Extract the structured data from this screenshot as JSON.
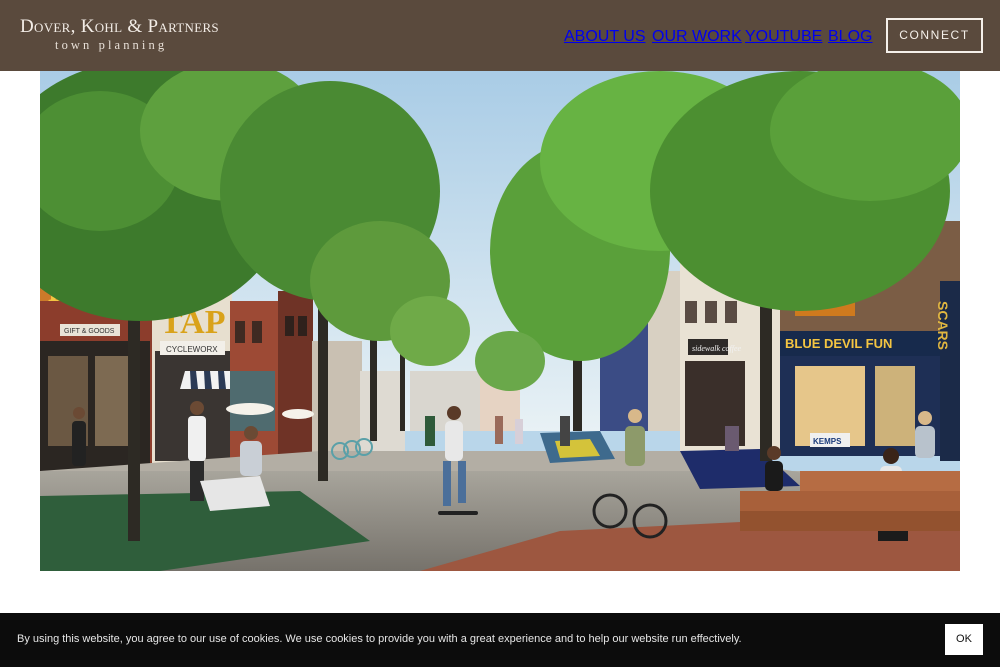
{
  "header": {
    "logo_name": "Dover, Kohl & Partners",
    "logo_sub": "town planning",
    "nav": {
      "about": "ABOUT US",
      "work": "OUR WORK",
      "youtube": "YOUTUBE",
      "blog": "BLOG",
      "connect": "CONNECT"
    }
  },
  "hero": {
    "signs": {
      "cyclewor": "CYCLEWORX",
      "gift": "GIFT & GOODS",
      "coffee": "sidewalk coffee",
      "devil": "BLUE DEVIL FUN",
      "scars": "SCARS",
      "kemps": "KEMPS"
    }
  },
  "cookie": {
    "text": "By using this website, you agree to our use of cookies. We use cookies to provide you with a great experience and to help our website run effectively.",
    "ok": "OK"
  },
  "colors": {
    "header_bg": "#5a4a3d",
    "cookie_bg": "#0c0c0c"
  }
}
